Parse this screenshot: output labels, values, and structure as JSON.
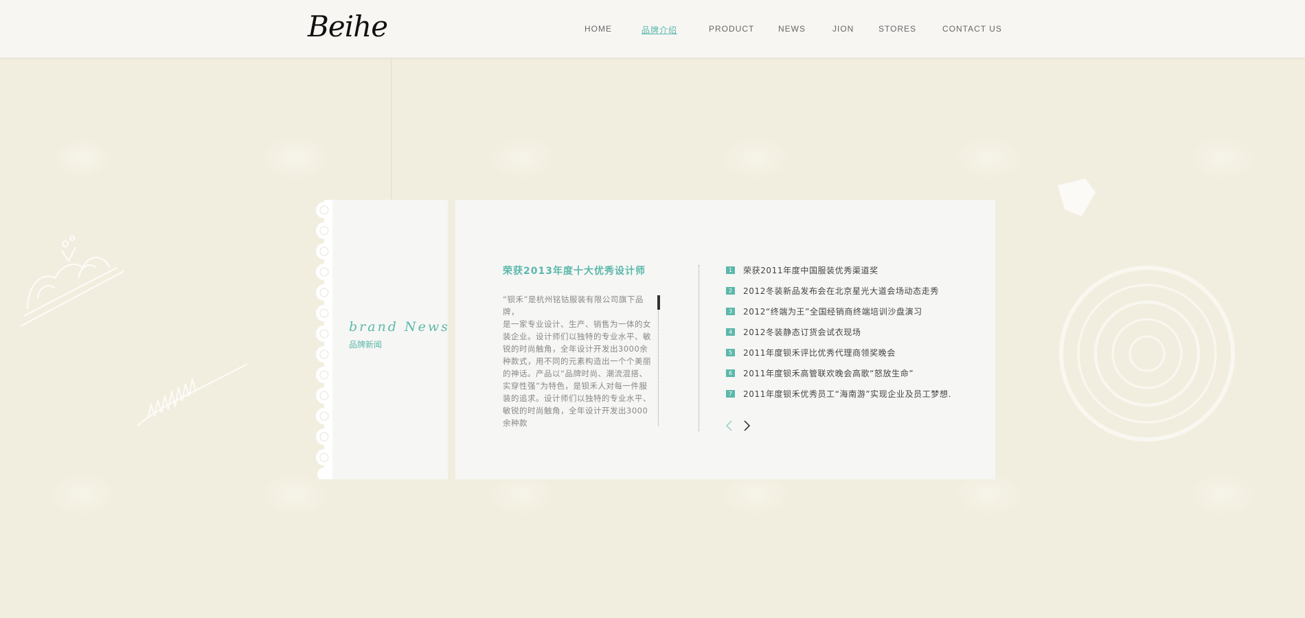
{
  "header": {
    "logo": "Beihe",
    "nav": [
      {
        "label": "HOME",
        "active": false
      },
      {
        "label": "品牌介绍",
        "active": true
      },
      {
        "label": "PRODUCT",
        "active": false
      },
      {
        "label": "NEWS",
        "active": false
      },
      {
        "label": "JION",
        "active": false
      },
      {
        "label": "STORES",
        "active": false
      },
      {
        "label": "CONTACT US",
        "active": false
      }
    ]
  },
  "side": {
    "title_en": "brand News",
    "title_cn": "品牌新闻"
  },
  "article": {
    "title": "荣获2013年度十大优秀设计师",
    "body": "“钡禾”是杭州铭钴服装有限公司旗下品牌，\n是一家专业设计、生产、销售为一体的女装企业。设计师们以独特的专业水平、敏锐的时尚触角，全年设计开发出3000余种款式，用不同的元素构造出一个个美丽的神话。产品以“品牌时尚、潮流混搭、实穿性强”为特色，是钡禾人对每一件服装的追求。设计师们以独特的专业水平、敏锐的时尚触角，全年设计开发出3000余种款"
  },
  "news": [
    {
      "num": "1",
      "text": "荣获2011年度中国服装优秀渠道奖"
    },
    {
      "num": "2",
      "text": "2012冬装新品发布会在北京星光大道会场动态走秀"
    },
    {
      "num": "3",
      "text": "2012“终端为王”全国经销商终端培训沙盘演习"
    },
    {
      "num": "4",
      "text": "2012冬装静态订货会试衣现场"
    },
    {
      "num": "5",
      "text": "2011年度钡禾评比优秀代理商领奖晚会"
    },
    {
      "num": "6",
      "text": "2011年度钡禾高管联欢晚会高歌“怒放生命”"
    },
    {
      "num": "7",
      "text": "2011年度钡禾优秀员工“海南游”实现企业及员工梦想."
    }
  ],
  "pager": {
    "prev_icon": "chevron-left-icon",
    "next_icon": "chevron-right-icon"
  },
  "colors": {
    "accent": "#5bb8ab",
    "background": "#f2eedf",
    "panel": "#f6f6f4"
  }
}
